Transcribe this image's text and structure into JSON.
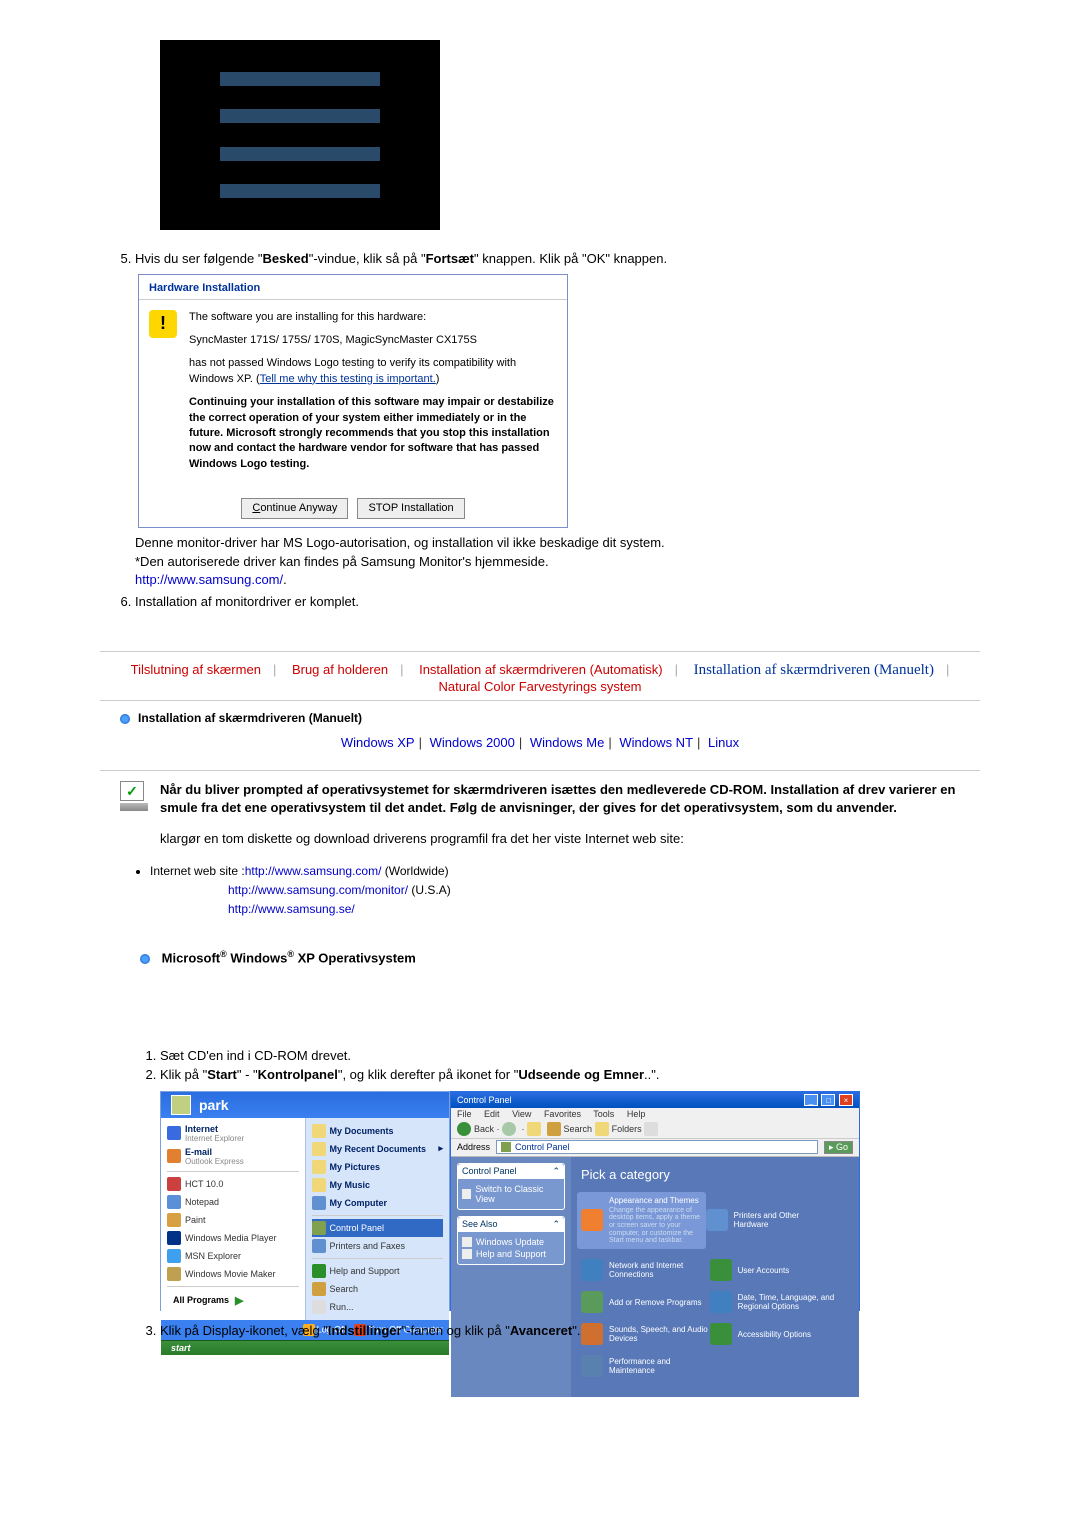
{
  "step5": {
    "text_prefix": "Hvis du ser følgende \"",
    "bold1": "Besked",
    "text_mid": "\"-vindue, klik så på \"",
    "bold2": "Fortsæt",
    "text_after": "\" knappen. Klik på \"OK\" knappen."
  },
  "dialog": {
    "title": "Hardware Installation",
    "line1": "The software you are installing for this hardware:",
    "line2": "SyncMaster 171S/ 175S/ 170S, MagicSyncMaster CX175S",
    "line3": "has not passed Windows Logo testing to verify its compatibility with Windows XP. (",
    "line3link": "Tell me why this testing is important.",
    "line3end": ")",
    "bold": "Continuing your installation of this software may impair or destabilize the correct operation of your system either immediately or in the future. Microsoft strongly recommends that you stop this installation now and contact the hardware vendor for software that has passed Windows Logo testing.",
    "btn_continue": "Continue Anyway",
    "btn_stop": "STOP Installation"
  },
  "step5_after": {
    "line1": "Denne monitor-driver har MS Logo-autorisation, og installation vil ikke beskadige dit system.",
    "line2": "*Den autoriserede driver kan findes på Samsung Monitor's hjemmeside.",
    "link": "http://www.samsung.com/",
    "dot": "."
  },
  "step6": "Installation af monitordriver er komplet.",
  "tabs": {
    "t1": "Tilslutning af skærmen",
    "t2": "Brug af holderen",
    "t3": "Installation af skærmdriveren (Automatisk)",
    "t4": "Installation af skærmdriveren (Manuelt)",
    "t5": "Natural Color Farvestyrings system"
  },
  "section_title": "Installation af skærmdriveren (Manuelt)",
  "os_links": {
    "xp": "Windows XP",
    "w2000": "Windows 2000",
    "wme": "Windows Me",
    "wnt": "Windows NT",
    "linux": "Linux"
  },
  "prompt": {
    "bold": "Når du bliver prompted af operativsystemet for skærmdriveren isættes den medleverede CD-ROM. Installation af drev varierer en smule fra det ene operativsystem til det andet. Følg de anvisninger, der gives for det operativsystem, som du anvender.",
    "reg": "klargør en tom diskette og download driverens programfil fra det her viste Internet web site:"
  },
  "websites": {
    "label_prefix": "Internet web site :",
    "url1": "http://www.samsung.com/",
    "url1_suffix": " (Worldwide)",
    "url2": "http://www.samsung.com/monitor/",
    "url2_suffix": " (U.S.A)",
    "url3": "http://www.samsung.se/"
  },
  "os_heading": {
    "p1": "Microsoft",
    "p2": " Windows",
    "p3": " XP Operativsystem"
  },
  "lower_steps": {
    "s1": "Sæt CD'en ind i CD-ROM drevet.",
    "s2_pre": "Klik på \"",
    "s2_b1": "Start",
    "s2_mid1": "\" - \"",
    "s2_b2": "Kontrolpanel",
    "s2_mid2": "\", og klik derefter på ikonet for \"",
    "s2_b3": "Udseende og Emner",
    "s2_end": "..\".",
    "s3_pre": "Klik på Display-ikonet, vælg \"",
    "s3_b1": "Indstillinger",
    "s3_mid": "\"-fanen og klik på \"",
    "s3_b2": "Avanceret",
    "s3_end": "\"."
  },
  "startmenu": {
    "user": "park",
    "left": {
      "internet": "Internet",
      "internet_sub": "Internet Explorer",
      "email": "E-mail",
      "email_sub": "Outlook Express",
      "hct": "HCT 10.0",
      "notepad": "Notepad",
      "paint": "Paint",
      "wmp": "Windows Media Player",
      "msn": "MSN Explorer",
      "wmm": "Windows Movie Maker",
      "allprog": "All Programs"
    },
    "right": {
      "mydocs": "My Documents",
      "recent": "My Recent Documents",
      "mypics": "My Pictures",
      "mymusic": "My Music",
      "mycomp": "My Computer",
      "control": "Control Panel",
      "printers": "Printers and Faxes",
      "help": "Help and Support",
      "search": "Search",
      "run": "Run..."
    },
    "footer": {
      "logoff": "Log Off",
      "turnoff": "Turn Off Computer"
    },
    "start": "start"
  },
  "controlpanel": {
    "title": "Control Panel",
    "menu": {
      "file": "File",
      "edit": "Edit",
      "view": "View",
      "fav": "Favorites",
      "tools": "Tools",
      "help": "Help"
    },
    "tools": {
      "back": "Back",
      "search": "Search",
      "folders": "Folders"
    },
    "addr_label": "Address",
    "addr_value": "Control Panel",
    "go": "Go",
    "side_header": "Control Panel",
    "side_switch": "Switch to Classic View",
    "side_seealso": "See Also",
    "side_wu": "Windows Update",
    "side_hs": "Help and Support",
    "pick": "Pick a category",
    "cats": {
      "c1": "Appearance and Themes",
      "c1_sub": "Change the appearance of desktop items, apply a theme or screen saver to your computer, or customize the Start menu and taskbar.",
      "c2": "Printers and Other Hardware",
      "c3": "Network and Internet Connections",
      "c4": "User Accounts",
      "c5": "Add or Remove Programs",
      "c6": "Date, Time, Language, and Regional Options",
      "c7": "Sounds, Speech, and Audio Devices",
      "c8": "Accessibility Options",
      "c9": "Performance and Maintenance"
    }
  }
}
